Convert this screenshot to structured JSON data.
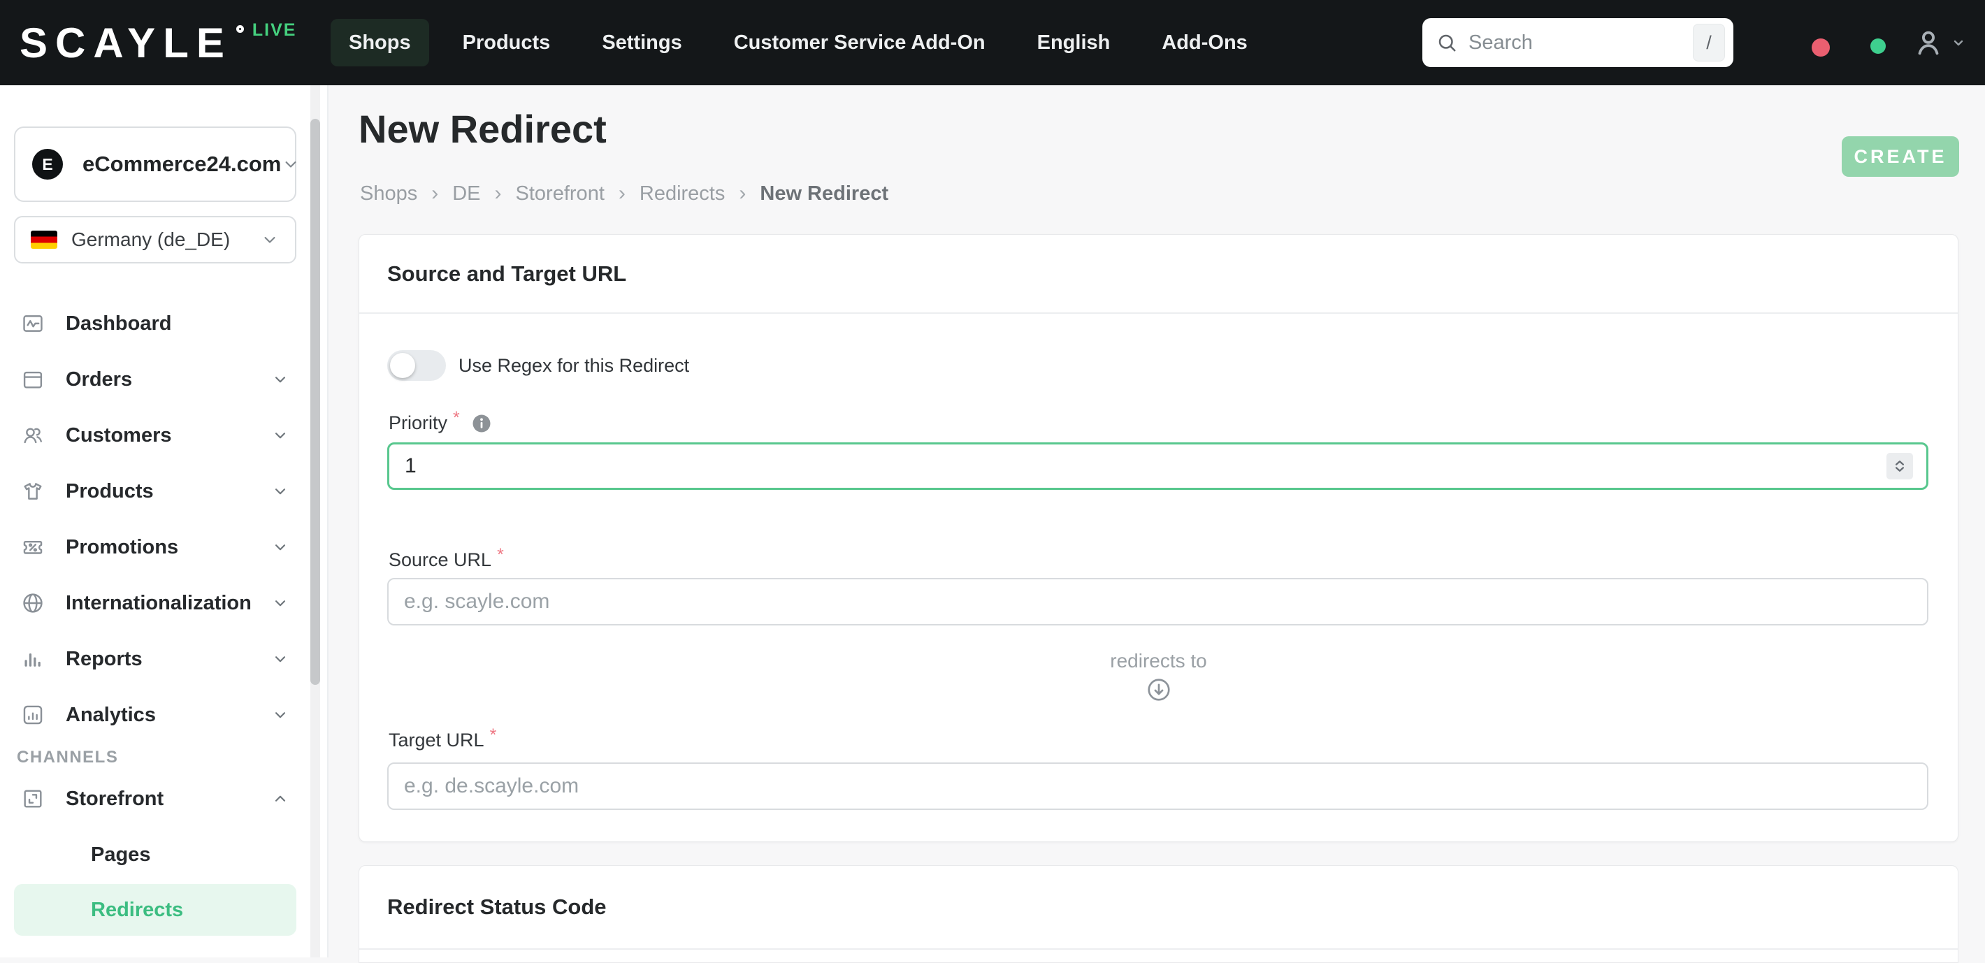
{
  "topbar": {
    "logo": "SCAYLE",
    "live": "LIVE",
    "nav": [
      {
        "label": "Shops",
        "active": true
      },
      {
        "label": "Products",
        "active": false
      },
      {
        "label": "Settings",
        "active": false
      },
      {
        "label": "Customer Service Add-On",
        "active": false
      },
      {
        "label": "English",
        "active": false
      },
      {
        "label": "Add-Ons",
        "active": false
      }
    ],
    "search_placeholder": "Search",
    "search_shortcut": "/"
  },
  "sidebar": {
    "shop_initial": "E",
    "shop_name": "eCommerce24.com",
    "locale": "Germany (de_DE)",
    "menu": [
      {
        "label": "Dashboard"
      },
      {
        "label": "Orders"
      },
      {
        "label": "Customers"
      },
      {
        "label": "Products"
      },
      {
        "label": "Promotions"
      },
      {
        "label": "Internationalization"
      },
      {
        "label": "Reports"
      },
      {
        "label": "Analytics"
      }
    ],
    "section": "CHANNELS",
    "storefront": "Storefront",
    "sub_items": [
      {
        "label": "Pages",
        "active": false
      },
      {
        "label": "Redirects",
        "active": true
      }
    ]
  },
  "main": {
    "title": "New Redirect",
    "breadcrumb": [
      {
        "label": "Shops"
      },
      {
        "label": "DE"
      },
      {
        "label": "Storefront"
      },
      {
        "label": "Redirects"
      },
      {
        "label": "New Redirect"
      }
    ],
    "breadcrumb_sep": "›",
    "create_label": "CREATE",
    "required_mark": "*",
    "source_card": {
      "title": "Source and Target URL",
      "regex_label": "Use Regex for this Redirect",
      "priority_label": "Priority",
      "priority_value": "1",
      "source_label": "Source URL",
      "source_placeholder": "e.g. scayle.com",
      "redirects_to": "redirects to",
      "target_label": "Target URL",
      "target_placeholder": "e.g. de.scayle.com"
    },
    "status_card": {
      "title": "Redirect Status Code"
    }
  },
  "colors": {
    "topbar_bg": "#141719",
    "active_tab_bg": "#1d2b24",
    "brand_green": "#3cbd81",
    "create_button_green": "#93d5ac",
    "live_green": "#45d07e",
    "notification_red": "#ea5f70",
    "notification_green": "#3ecf8e",
    "active_item_bg": "#e7f7ee",
    "focus_border_green": "#58c78e"
  }
}
